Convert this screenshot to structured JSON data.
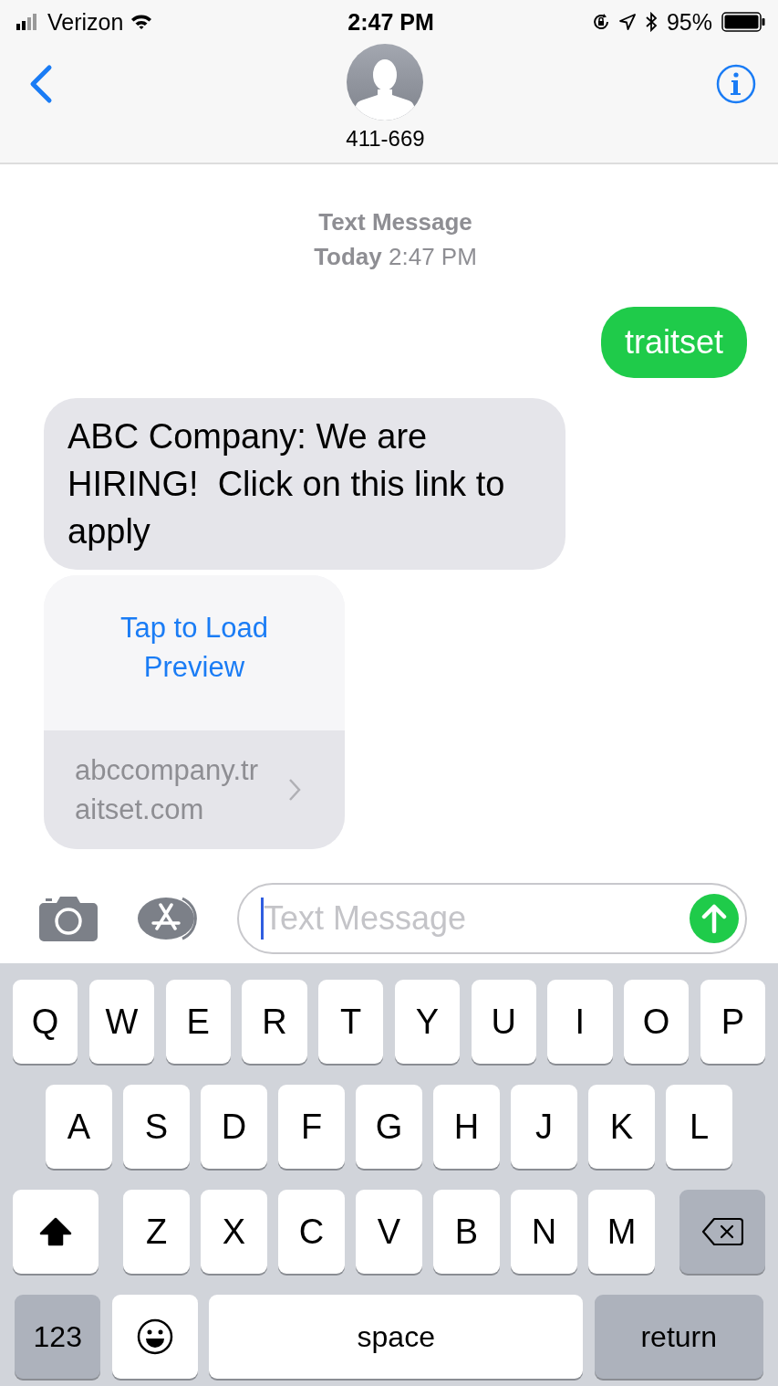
{
  "status_bar": {
    "carrier": "Verizon",
    "time": "2:47 PM",
    "battery": "95%"
  },
  "header": {
    "contact": "411-669"
  },
  "thread": {
    "service": "Text Message",
    "day": "Today",
    "time": "2:47 PM"
  },
  "messages": [
    {
      "kind": "sent",
      "text": "traitset"
    },
    {
      "kind": "received",
      "text": "ABC Company: We are HIRING!  Click on this link to apply"
    },
    {
      "kind": "link_preview",
      "action": "Tap to Load Preview",
      "url": "abccompany.traitset.com"
    }
  ],
  "compose": {
    "placeholder": "Text Message"
  },
  "keyboard": {
    "rows": [
      {
        "keys": [
          {
            "kind": "letter",
            "label": "Q"
          },
          {
            "kind": "letter",
            "label": "W"
          },
          {
            "kind": "letter",
            "label": "E"
          },
          {
            "kind": "letter",
            "label": "R"
          },
          {
            "kind": "letter",
            "label": "T"
          },
          {
            "kind": "letter",
            "label": "Y"
          },
          {
            "kind": "letter",
            "label": "U"
          },
          {
            "kind": "letter",
            "label": "I"
          },
          {
            "kind": "letter",
            "label": "O"
          },
          {
            "kind": "letter",
            "label": "P"
          }
        ]
      },
      {
        "keys": [
          {
            "kind": "letter",
            "label": "A"
          },
          {
            "kind": "letter",
            "label": "S"
          },
          {
            "kind": "letter",
            "label": "D"
          },
          {
            "kind": "letter",
            "label": "F"
          },
          {
            "kind": "letter",
            "label": "G"
          },
          {
            "kind": "letter",
            "label": "H"
          },
          {
            "kind": "letter",
            "label": "J"
          },
          {
            "kind": "letter",
            "label": "K"
          },
          {
            "kind": "letter",
            "label": "L"
          }
        ]
      },
      {
        "keys": [
          {
            "kind": "shift",
            "on": true
          },
          {
            "kind": "letter",
            "label": "Z"
          },
          {
            "kind": "letter",
            "label": "X"
          },
          {
            "kind": "letter",
            "label": "C"
          },
          {
            "kind": "letter",
            "label": "V"
          },
          {
            "kind": "letter",
            "label": "B"
          },
          {
            "kind": "letter",
            "label": "N"
          },
          {
            "kind": "letter",
            "label": "M"
          },
          {
            "kind": "delete"
          }
        ]
      },
      {
        "keys": [
          {
            "kind": "numbers",
            "label": "123"
          },
          {
            "kind": "emoji"
          },
          {
            "kind": "space",
            "label": "space"
          },
          {
            "kind": "return",
            "label": "return"
          }
        ]
      }
    ]
  }
}
